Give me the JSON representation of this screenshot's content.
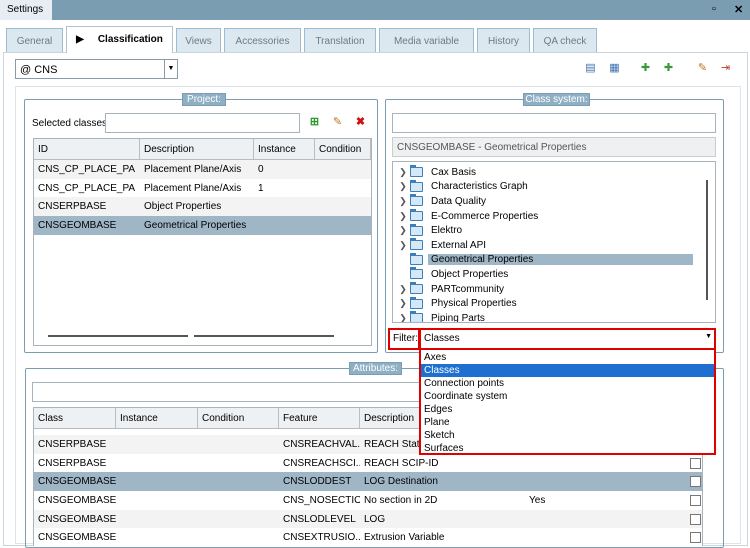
{
  "window": {
    "title": "Settings",
    "maximize_icon": "maximize-icon",
    "close_icon": "close-icon"
  },
  "tabs": [
    {
      "label": "General"
    },
    {
      "label": "Classification",
      "active": true
    },
    {
      "label": "Views"
    },
    {
      "label": "Accessories"
    },
    {
      "label": "Translation"
    },
    {
      "label": "Media variable"
    },
    {
      "label": "History"
    },
    {
      "label": "QA check"
    }
  ],
  "cns_combo": {
    "value": "@  CNS"
  },
  "toolbar_icons": [
    "save-table-icon",
    "new-table-icon",
    "warning-puzzle-icon",
    "puzzle-icon",
    "edit-document-icon",
    "export-document-icon"
  ],
  "project": {
    "legend": "Project:",
    "selected_classes_label": "Selected classes",
    "selected_classes_value": "",
    "columns": [
      "ID",
      "Description",
      "Instance",
      "Condition"
    ],
    "rows": [
      [
        "CNS_CP_PLACE_PA",
        "Placement Plane/Axis",
        "0",
        ""
      ],
      [
        "CNS_CP_PLACE_PA",
        "Placement Plane/Axis",
        "1",
        ""
      ],
      [
        "CNSERPBASE",
        "Object Properties",
        "",
        ""
      ],
      [
        "CNSGEOMBASE",
        "Geometrical Properties",
        "",
        ""
      ]
    ],
    "selected_row": 3
  },
  "class_system": {
    "legend": "Class system:",
    "search_value": "",
    "info": "CNSGEOMBASE - Geometrical Properties",
    "tree": [
      {
        "label": "Cax Basis",
        "expandable": true
      },
      {
        "label": "Characteristics Graph",
        "expandable": true
      },
      {
        "label": "Data Quality",
        "expandable": true
      },
      {
        "label": "E-Commerce Properties",
        "expandable": true
      },
      {
        "label": "Elektro",
        "expandable": true
      },
      {
        "label": "External API",
        "expandable": true
      },
      {
        "label": "Geometrical Properties",
        "expandable": false,
        "selected": true
      },
      {
        "label": "Object Properties",
        "expandable": false
      },
      {
        "label": "PARTcommunity",
        "expandable": true
      },
      {
        "label": "Physical Properties",
        "expandable": true
      },
      {
        "label": "Piping Parts",
        "expandable": true
      }
    ],
    "filter_label": "Filter:",
    "filter_value": "Classes",
    "filter_options": [
      "Axes",
      "Classes",
      "Connection points",
      "Coordinate system",
      "Edges",
      "Plane",
      "Sketch",
      "Surfaces"
    ],
    "highlight_color": "#e00000"
  },
  "attributes": {
    "legend": "Attributes:",
    "search_value": "",
    "columns": [
      "Class",
      "Instance",
      "Condition",
      "Feature",
      "Description"
    ],
    "rows": [
      [
        "CNSERPBASE",
        "",
        "",
        "CNSREACHVAL...",
        "REACH Status",
        ""
      ],
      [
        "CNSERPBASE",
        "",
        "",
        "CNSREACHSCI...",
        "REACH SCIP-ID",
        ""
      ],
      [
        "CNSGEOMBASE",
        "",
        "",
        "CNSLODDEST",
        "LOG Destination",
        ""
      ],
      [
        "CNSGEOMBASE",
        "",
        "",
        "CNS_NOSECTION",
        "No section in 2D",
        "Yes"
      ],
      [
        "CNSGEOMBASE",
        "",
        "",
        "CNSLODLEVEL",
        "LOG",
        ""
      ],
      [
        "CNSGEOMBASE",
        "",
        "",
        "CNSEXTRUSIO...",
        "Extrusion Variable",
        ""
      ]
    ],
    "selected_row": 2
  }
}
